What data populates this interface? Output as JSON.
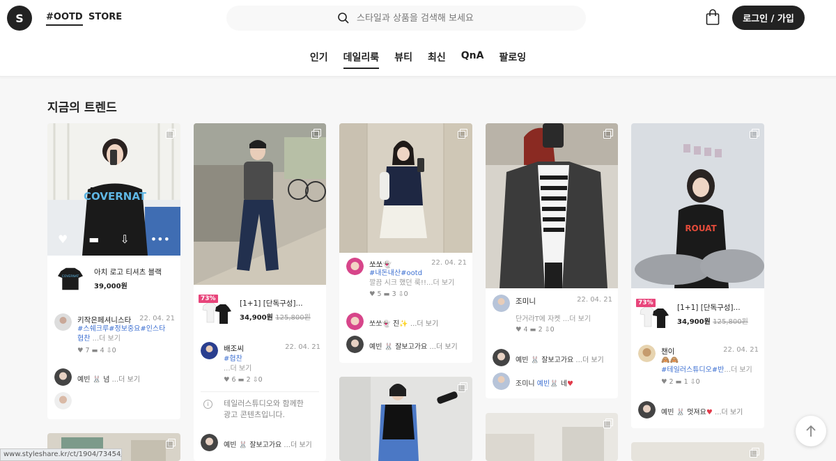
{
  "header": {
    "logo": "S",
    "nav_ootd": "#OOTD",
    "nav_store": "STORE",
    "search_placeholder": "스타일과 상품을 검색해 보세요",
    "login": "로그인 / 가입"
  },
  "tabs": [
    "인기",
    "데일리룩",
    "뷰티",
    "최신",
    "QnA",
    "팔로잉"
  ],
  "section_title": "지금의 트렌드",
  "cards": [
    {
      "product": {
        "name": "아치 로고 티셔츠 블랙",
        "price": "39,000원"
      },
      "author": {
        "name": "키작은페셔니스타",
        "date": "22. 04. 21",
        "tags": "#스쉐크루#정보중요#인스타",
        "tags2": "협찬",
        "more": "...더 보기",
        "likes": "7",
        "comments": "4",
        "saves": "0"
      },
      "comment1": {
        "name": "예빈",
        "emoji": "🐰",
        "text": "넘",
        "more": "...더 보기"
      }
    },
    {
      "product": {
        "discount": "73%",
        "name": "[1+1] [단독구성]...",
        "price": "34,900원",
        "old_price": "125,800원"
      },
      "author": {
        "name": "배조씨",
        "date": "22. 04. 21",
        "tags": "#협찬",
        "more": "...더 보기",
        "likes": "6",
        "comments": "2",
        "saves": "0"
      },
      "ad": {
        "line1": "테일러스튜디오와 함께한",
        "line2": "광고 콘텐츠입니다."
      },
      "comment1": {
        "name": "예빈",
        "emoji": "🐰",
        "text": "잘보고가요",
        "more": "...더 보기"
      }
    },
    {
      "author": {
        "name": "쏘쏘",
        "name_emoji": "👻",
        "date": "22. 04. 21",
        "tags": "#내돈내산#ootd",
        "text": "깔끔 시크 했던 룩!!",
        "more": "...더 보기",
        "likes": "5",
        "comments": "3",
        "saves": "0"
      },
      "comment1": {
        "name": "쏘쏘",
        "emoji": "👻",
        "text": "진✨",
        "more": "...더 보기"
      },
      "comment2": {
        "name": "예빈",
        "emoji": "🐰",
        "text": "잘보고가요",
        "more": "...더 보기"
      }
    },
    {
      "author": {
        "name": "조미니",
        "date": "22. 04. 21",
        "text": "단거라T에 자켓",
        "more": "...더 보기",
        "likes": "4",
        "comments": "2",
        "saves": "0"
      },
      "comment1": {
        "name": "예빈",
        "emoji": "🐰",
        "text": "잘보고가요",
        "more": "...더 보기"
      },
      "comment2": {
        "name": "조미니",
        "mention": "예빈",
        "emoji": "🐰",
        "text": "네",
        "heart": "♥"
      }
    },
    {
      "product": {
        "discount": "73%",
        "name": "[1+1] [단독구성]...",
        "price": "34,900원",
        "old_price": "125,800원"
      },
      "author": {
        "name": "챈이",
        "date": "22. 04. 21",
        "emoji": "🙈🙈",
        "tags": "#테일러스튜디오#반",
        "more": "...더 보기",
        "likes": "2",
        "comments": "1",
        "saves": "0"
      },
      "comment1": {
        "name": "예빈",
        "emoji": "🐰",
        "text": "멋져요",
        "heart": "♥",
        "more": "...더 보기"
      }
    }
  ],
  "status_url": "www.styleshare.kr/ct/1904/73454/"
}
